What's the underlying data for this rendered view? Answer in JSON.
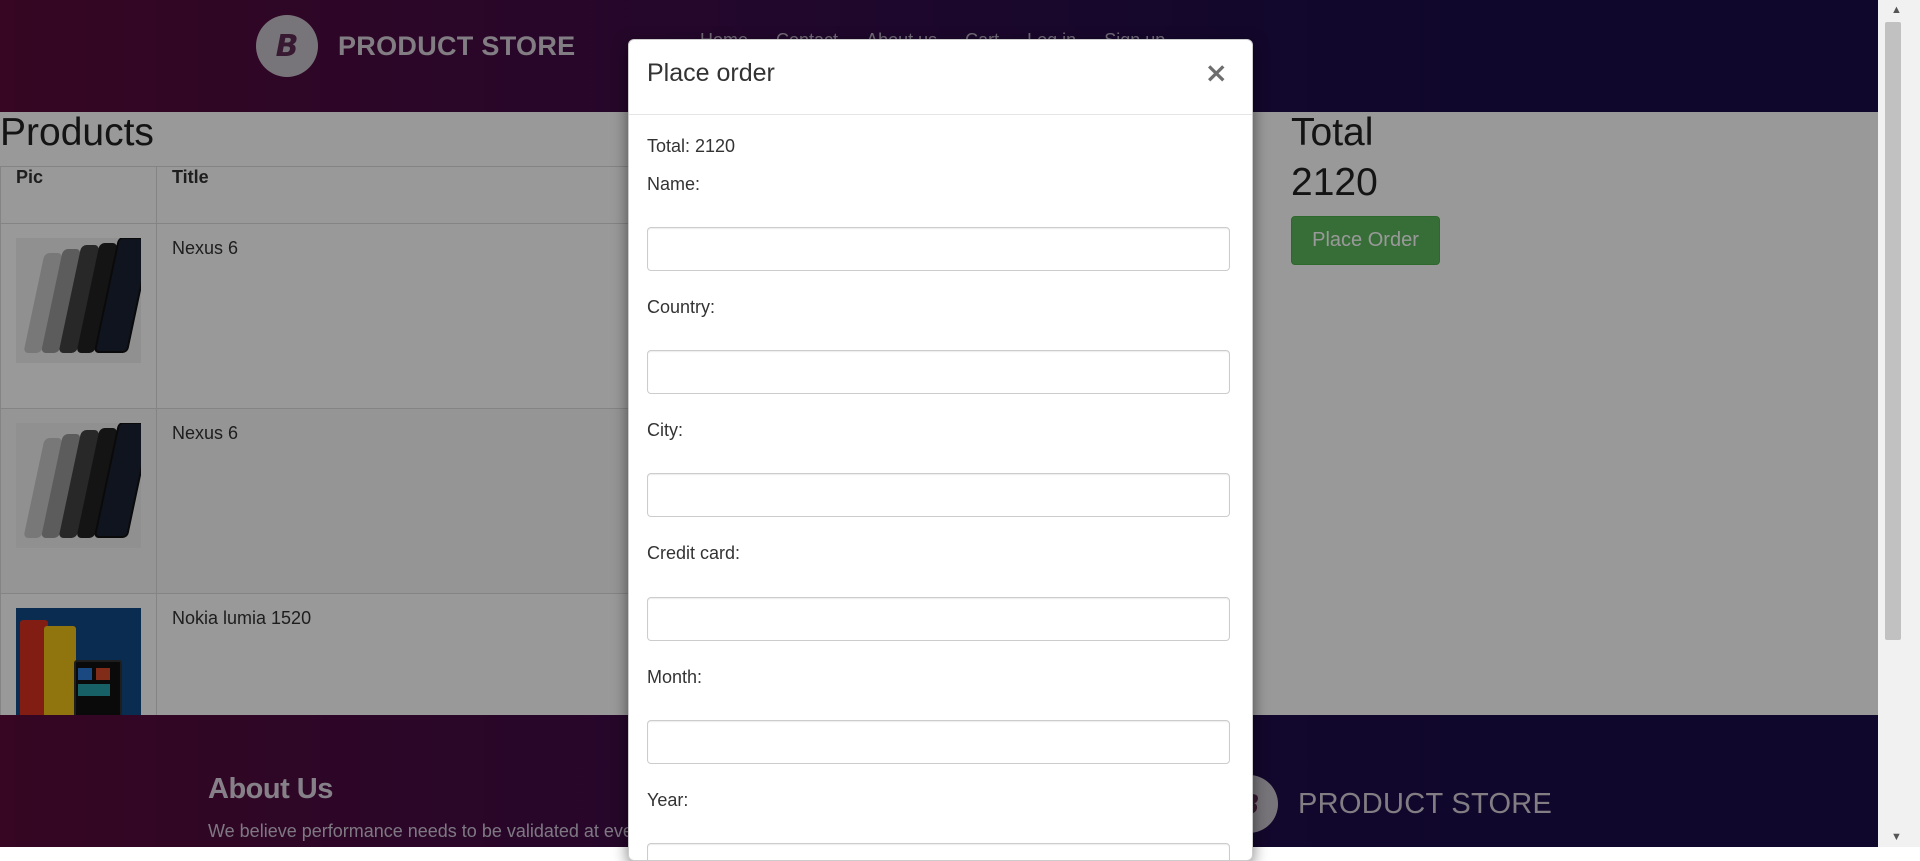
{
  "brand": {
    "name": "PRODUCT STORE",
    "logo_letter": "B"
  },
  "nav": {
    "items": [
      "Home",
      "Contact",
      "About us",
      "Cart",
      "Log in",
      "Sign up"
    ]
  },
  "cart": {
    "products_title": "Products",
    "total_title": "Total",
    "total_value": "2120",
    "place_order_label": "Place Order",
    "columns": {
      "pic": "Pic",
      "title": "Title"
    },
    "rows": [
      {
        "title": "Nexus 6"
      },
      {
        "title": "Nexus 6"
      },
      {
        "title": "Nokia lumia 1520"
      }
    ]
  },
  "footer": {
    "about_title": "About Us",
    "about_text": "We believe performance needs to be validated at eve",
    "brand_name": "PRODUCT STORE",
    "logo_letter": "B"
  },
  "modal": {
    "title": "Place order",
    "close_glyph": "×",
    "total_text": "Total: 2120",
    "fields": {
      "name": {
        "label": "Name:",
        "value": ""
      },
      "country": {
        "label": "Country:",
        "value": ""
      },
      "city": {
        "label": "City:",
        "value": ""
      },
      "card": {
        "label": "Credit card:",
        "value": ""
      },
      "month": {
        "label": "Month:",
        "value": ""
      },
      "year": {
        "label": "Year:",
        "value": ""
      }
    }
  },
  "colors": {
    "accent_green": "#5cb85c",
    "header_gradient_start": "#5a0a3a",
    "header_gradient_end": "#1b0c4a"
  },
  "icons": {
    "close": "close-icon",
    "logo": "brand-logo-icon"
  }
}
